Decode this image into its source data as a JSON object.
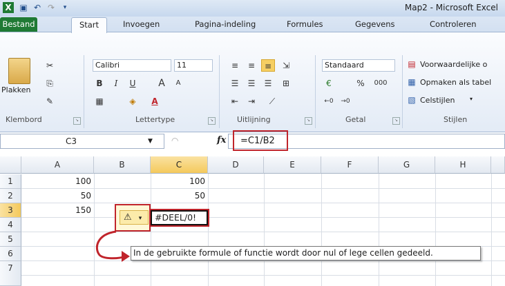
{
  "window": {
    "title": "Map2  -  Microsoft Excel"
  },
  "ribbon_tabs": [
    "Bestand",
    "Start",
    "Invoegen",
    "Pagina-indeling",
    "Formules",
    "Gegevens",
    "Controleren"
  ],
  "clipboard": {
    "paste_label": "Plakken",
    "group_label": "Klembord"
  },
  "font": {
    "name": "Calibri",
    "size": "11",
    "group_label": "Lettertype",
    "bold": "B",
    "italic": "I",
    "underline": "U",
    "grow": "A",
    "shrink": "A"
  },
  "alignment": {
    "group_label": "Uitlijning"
  },
  "number": {
    "format": "Standaard",
    "percent": "%",
    "thousands": "000",
    "group_label": "Getal"
  },
  "styles": {
    "conditional": "Voorwaardelijke o",
    "as_table": "Opmaken als tabel",
    "cell_styles": "Celstijlen",
    "group_label": "Stijlen"
  },
  "namebox": {
    "value": "C3"
  },
  "formula": {
    "fx": "fx",
    "value": "=C1/B2"
  },
  "columns": [
    "A",
    "B",
    "C",
    "D",
    "E",
    "F",
    "G",
    "H"
  ],
  "rows": [
    "1",
    "2",
    "3",
    "4",
    "5",
    "6",
    "7"
  ],
  "cells": {
    "A1": "100",
    "A2": "50",
    "A3": "150",
    "C1": "100",
    "C2": "50",
    "C3": "#DEEL/0!"
  },
  "error_button": {
    "icon": "⚠",
    "caret": "▾"
  },
  "tooltip": {
    "text": "In de gebruikte formule of functie wordt door nul of lege cellen gedeeld."
  },
  "colors": {
    "accent_red": "#c0242b",
    "file_tab": "#1f7a34",
    "active_header": "#f4c95c"
  }
}
